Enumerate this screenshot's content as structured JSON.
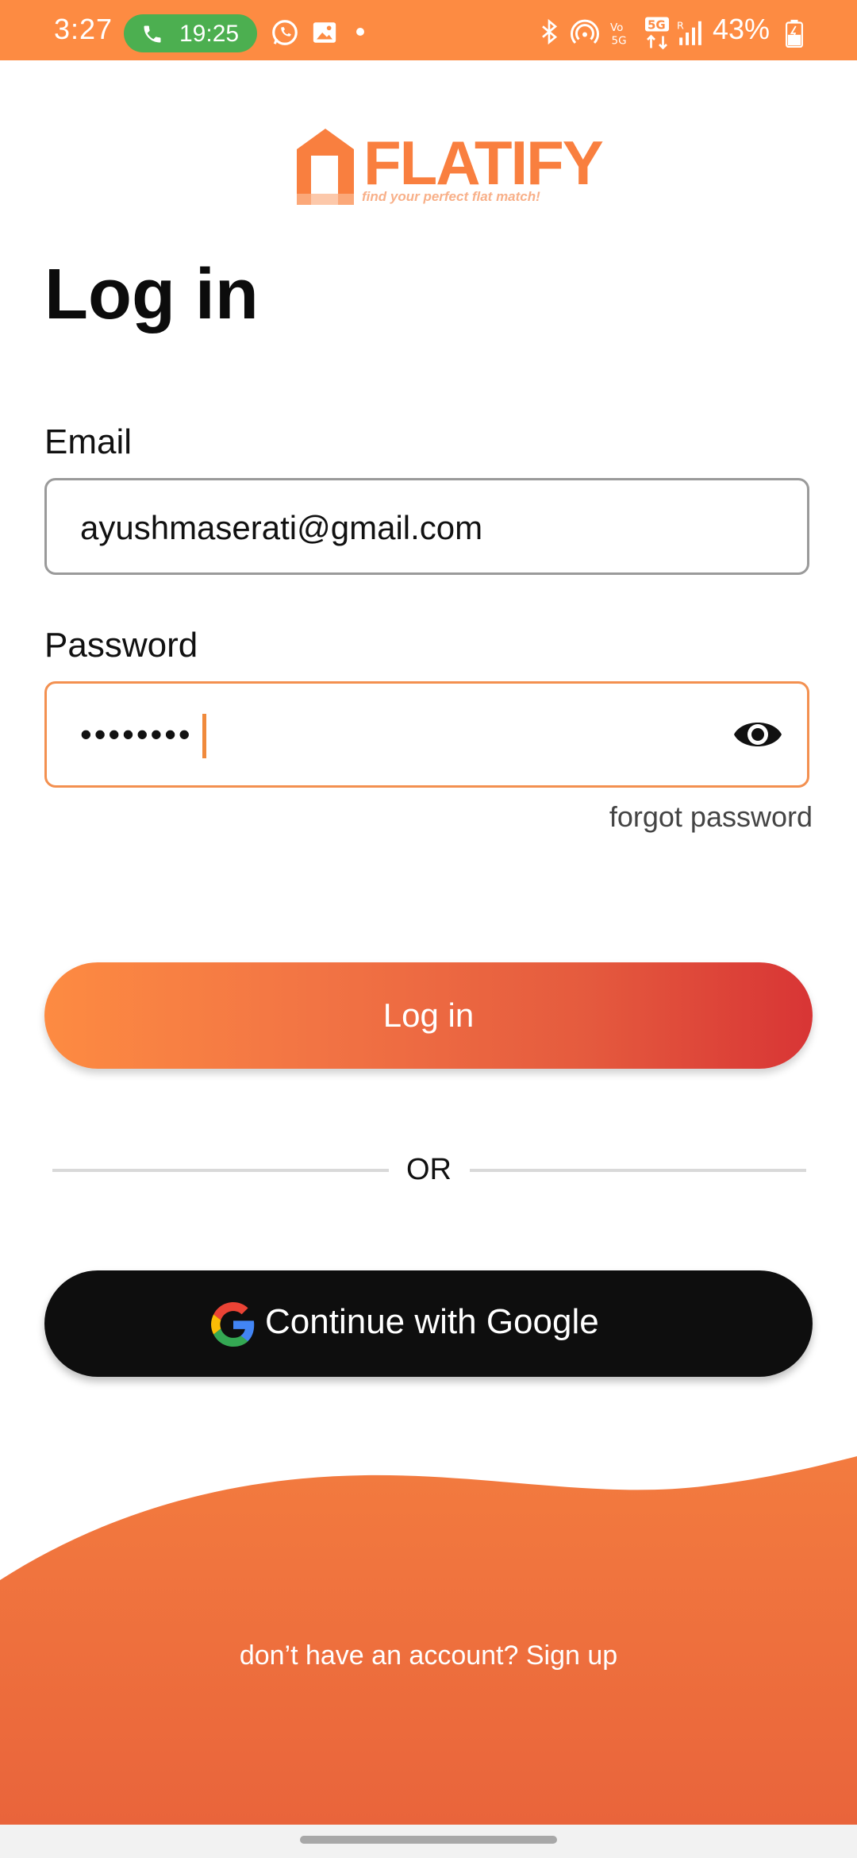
{
  "status_bar": {
    "time": "3:27",
    "call_timer": "19:25",
    "battery": "43%",
    "network_label": "5G",
    "icons": [
      "whatsapp-icon",
      "gallery-icon",
      "notification-dot-icon",
      "bluetooth-icon",
      "hotspot-icon",
      "volte-icon",
      "5g-icon",
      "signal-icon",
      "battery-icon"
    ]
  },
  "logo": {
    "word": "FLATIFY",
    "tagline": "find your perfect flat match!",
    "color": "#f97f3f"
  },
  "title": "Log in",
  "email": {
    "label": "Email",
    "value": "ayushmaserati@gmail.com"
  },
  "password": {
    "label": "Password",
    "value": "••••••••",
    "toggle_icon": "eye-icon"
  },
  "forgot_password": "forgot password",
  "login_button": "Log in",
  "divider": "OR",
  "google_button": "Continue with Google",
  "signup_prompt": "don’t have an account? Sign up",
  "colors": {
    "accent": "#fd8b42",
    "gradient_end": "#d83535",
    "google_button_bg": "#0e0e0e",
    "wave": "#f07a3e"
  }
}
